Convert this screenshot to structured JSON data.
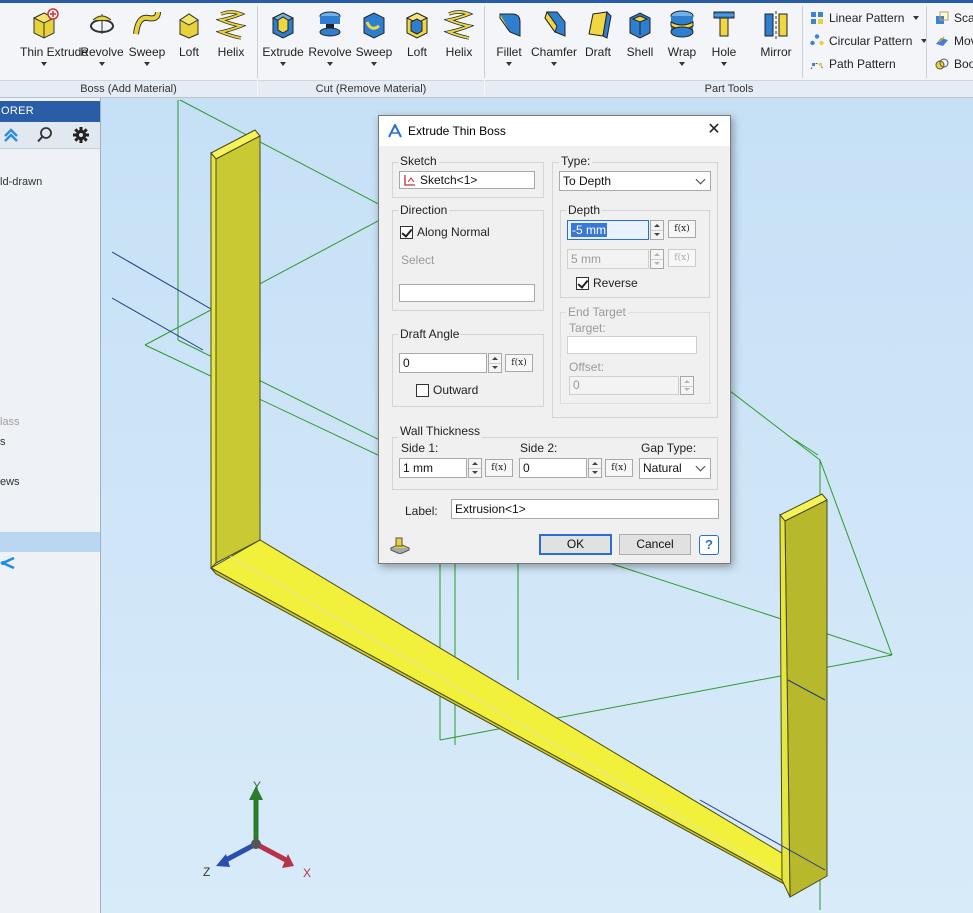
{
  "ribbon": {
    "boss_tools": [
      {
        "name": "thin-extrude-button",
        "label": "Thin Extrude",
        "has_menu": true
      },
      {
        "name": "revolve-boss-button",
        "label": "Revolve",
        "has_menu": true
      },
      {
        "name": "sweep-boss-button",
        "label": "Sweep",
        "has_menu": true
      },
      {
        "name": "loft-boss-button",
        "label": "Loft",
        "has_menu": false
      },
      {
        "name": "helix-boss-button",
        "label": "Helix",
        "has_menu": false
      }
    ],
    "cut_tools": [
      {
        "name": "extrude-cut-button",
        "label": "Extrude",
        "has_menu": true
      },
      {
        "name": "revolve-cut-button",
        "label": "Revolve",
        "has_menu": true
      },
      {
        "name": "sweep-cut-button",
        "label": "Sweep",
        "has_menu": true
      },
      {
        "name": "loft-cut-button",
        "label": "Loft",
        "has_menu": false
      },
      {
        "name": "helix-cut-button",
        "label": "Helix",
        "has_menu": false
      }
    ],
    "part_tools": [
      {
        "name": "fillet-button",
        "label": "Fillet",
        "has_menu": true
      },
      {
        "name": "chamfer-button",
        "label": "Chamfer",
        "has_menu": true
      },
      {
        "name": "draft-button",
        "label": "Draft",
        "has_menu": false
      },
      {
        "name": "shell-button",
        "label": "Shell",
        "has_menu": false
      },
      {
        "name": "wrap-button",
        "label": "Wrap",
        "has_menu": true
      },
      {
        "name": "hole-button",
        "label": "Hole",
        "has_menu": true
      },
      {
        "name": "mirror-button",
        "label": "Mirror",
        "has_menu": false
      }
    ],
    "patterns": [
      "Linear Pattern",
      "Circular Pattern",
      "Path Pattern"
    ],
    "right_tools": [
      "Sca",
      "Mov",
      "Boo"
    ],
    "groups": {
      "boss": "Boss (Add Material)",
      "cut": "Cut (Remove Material)",
      "part": "Part Tools"
    }
  },
  "explorer": {
    "title": "ORER",
    "items": [
      "ld-drawn",
      "lass",
      "s",
      "ews"
    ]
  },
  "dialog": {
    "title": "Extrude Thin Boss",
    "sketch": {
      "legend": "Sketch",
      "value": "Sketch<1>"
    },
    "direction": {
      "legend": "Direction",
      "along_normal": "Along Normal",
      "along_normal_checked": true,
      "select_label": "Select",
      "select_value": ""
    },
    "draft_angle": {
      "legend": "Draft Angle",
      "value": "0",
      "outward": "Outward",
      "outward_checked": false
    },
    "type": {
      "legend": "Type:",
      "value": "To Depth"
    },
    "depth": {
      "legend": "Depth",
      "value1": "-5 mm",
      "value2": "5 mm",
      "reverse": "Reverse",
      "reverse_checked": true
    },
    "end_target": {
      "legend": "End Target",
      "target_label": "Target:",
      "target_value": "",
      "offset_label": "Offset:",
      "offset_value": "0"
    },
    "wall": {
      "legend": "Wall Thickness",
      "side1_label": "Side 1:",
      "side1_value": "1 mm",
      "side2_label": "Side 2:",
      "side2_value": "0",
      "gap_label": "Gap Type:",
      "gap_value": "Natural"
    },
    "label": {
      "label": "Label:",
      "value": "Extrusion<1>"
    },
    "fx": "f(x)",
    "ok": "OK",
    "cancel": "Cancel",
    "help": "?"
  },
  "axes": {
    "x": "X",
    "y": "Y",
    "z": "Z"
  },
  "colors": {
    "accent": "#2a5da8",
    "part_yellow": "#e8e83a",
    "sketch_green": "#2e9a2e"
  }
}
